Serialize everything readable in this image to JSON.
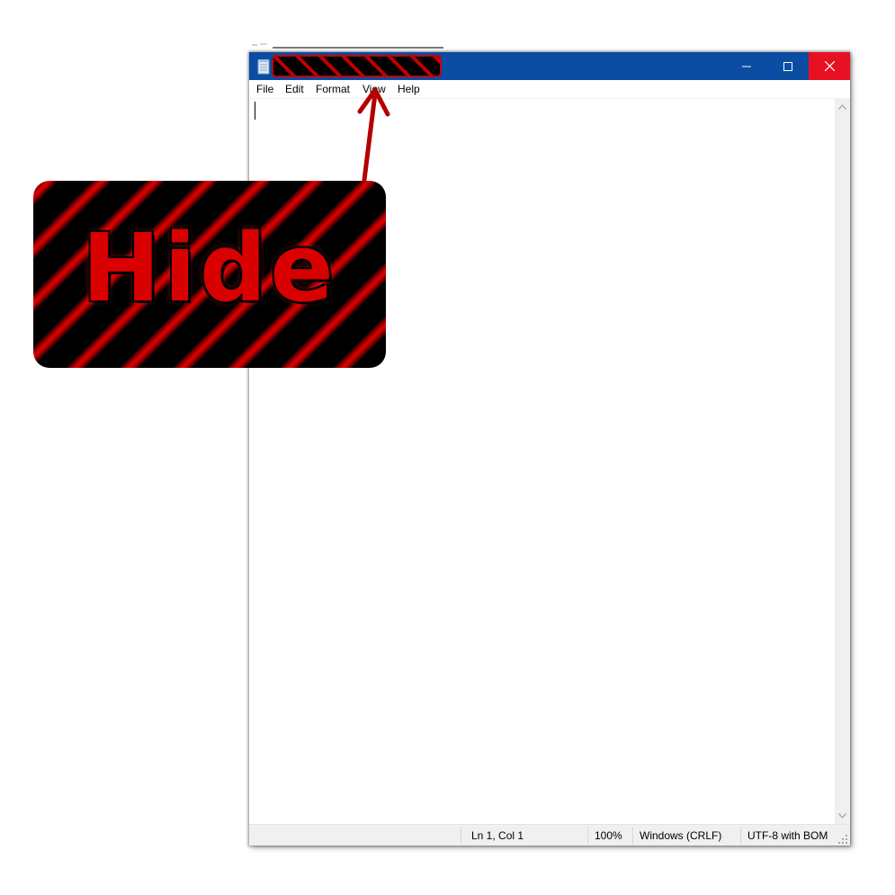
{
  "window": {
    "title": "",
    "controls": {
      "minimize": "minimize",
      "maximize": "maximize",
      "close": "close"
    }
  },
  "menu": {
    "items": [
      {
        "label": "File"
      },
      {
        "label": "Edit"
      },
      {
        "label": "Format"
      },
      {
        "label": "View"
      },
      {
        "label": "Help"
      }
    ]
  },
  "editor": {
    "content": ""
  },
  "status": {
    "position": "Ln 1, Col 1",
    "zoom": "100%",
    "line_endings": "Windows (CRLF)",
    "encoding": "UTF-8 with BOM"
  },
  "annotation": {
    "label": "Hide"
  },
  "colors": {
    "titlebar": "#0a4da2",
    "close_hover": "#e81123",
    "annotation_red": "#c40000",
    "statusbar": "#f0f0f0"
  },
  "icons": [
    "notepad-icon",
    "minimize-icon",
    "maximize-icon",
    "close-icon",
    "scroll-up-icon",
    "scroll-down-icon",
    "resize-grip-icon"
  ]
}
